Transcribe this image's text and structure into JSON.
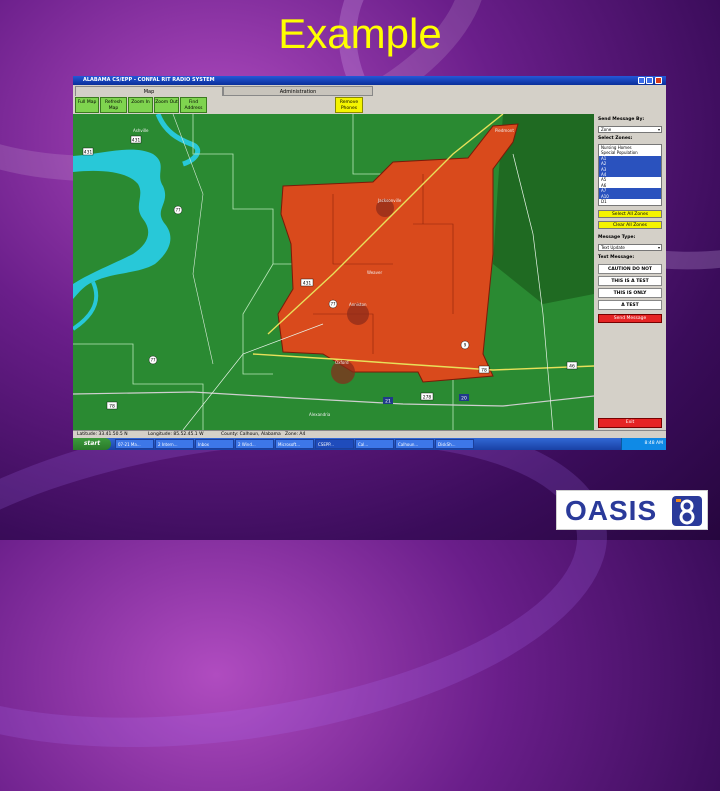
{
  "slide": {
    "title": "Example"
  },
  "app": {
    "window_title": "ALABAMA CS/EPP - CONFAL RIT RADIO SYSTEM"
  },
  "tabs": [
    {
      "label": "Map"
    },
    {
      "label": "Administration"
    }
  ],
  "toolbar": {
    "full_map": "Full Map",
    "refresh_map": "Refresh Map",
    "zoom_in": "Zoom In",
    "zoom_out": "Zoom Out",
    "find_address": "Find Address",
    "remove_phones": "Remove Phones"
  },
  "panel": {
    "send_by_label": "Send Message By:",
    "send_by_value": "Zone",
    "zones_label": "Select Zones:",
    "zones": [
      "Nursing Homes",
      "Special Population",
      "A1",
      "A2",
      "A3",
      "A4",
      "A5",
      "A6",
      "A7",
      "A10",
      "D1"
    ],
    "select_all": "Select All Zones",
    "clear_all": "Clear All Zones",
    "type_label": "Message Type:",
    "type_value": "Text Update",
    "text_label": "Text Message:",
    "messages": [
      "CAUTION DO NOT",
      "THIS IS A TEST",
      "THIS IS ONLY",
      "A TEST"
    ],
    "send": "Send Message",
    "exit": "Exit"
  },
  "map": {
    "routes": [
      "431",
      "431",
      "431",
      "77",
      "77",
      "77",
      "278",
      "78",
      "78",
      "20",
      "21",
      "9",
      "46"
    ],
    "places": [
      "Ashville",
      "Jacksonville",
      "Anniston",
      "Oxford",
      "Piedmont",
      "Weaver",
      "Alexandria"
    ]
  },
  "status": {
    "latitude": "Latitude: 33.41.50.5 N",
    "longitude": "Longitude: 85.52.45.1 W",
    "county": "County: Calhoun, Alabama",
    "zone": "Zone: A4"
  },
  "taskbar": {
    "start": "start",
    "tasks": [
      "07-21 Ma...",
      "2 Intern...",
      "Inbox",
      "2 Wind...",
      "Microsoft...",
      "CSEPP...",
      "Cal...",
      "Calhoun...",
      "DiskSh..."
    ],
    "clock": "8:48 AM"
  },
  "logo": {
    "text": "OASIS"
  },
  "colors": {
    "title": "#ffff00",
    "map_green": "#2a8a32",
    "zone_red": "#d94a1c",
    "water": "#28c8d8",
    "button_green": "#7fd44f",
    "button_yellow": "#f4f400",
    "button_red": "#e52424"
  }
}
